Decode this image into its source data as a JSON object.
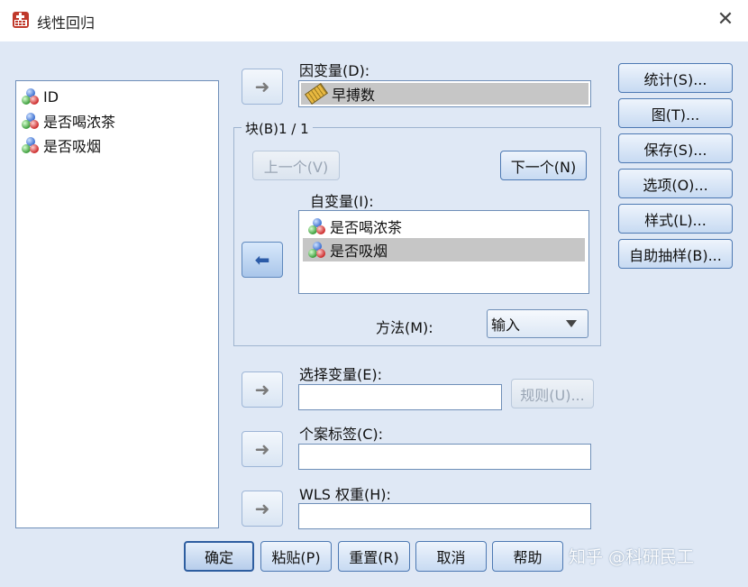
{
  "window": {
    "title": "线性回归",
    "close_glyph": "✕"
  },
  "source_list": {
    "items": [
      {
        "label": "ID",
        "icon": "nominal-icon"
      },
      {
        "label": "是否喝浓茶",
        "icon": "nominal-icon"
      },
      {
        "label": "是否吸烟",
        "icon": "nominal-icon"
      }
    ]
  },
  "dependent": {
    "label": "因变量(D):",
    "value": "早搏数",
    "icon": "scale-ruler-icon"
  },
  "block": {
    "legend": "块(B)1 / 1",
    "prev_label": "上一个(V)",
    "next_label": "下一个(N)"
  },
  "independent": {
    "label": "自变量(I):",
    "items": [
      {
        "label": "是否喝浓茶",
        "selected": false
      },
      {
        "label": "是否吸烟",
        "selected": true
      }
    ]
  },
  "method": {
    "label": "方法(M):",
    "value": "输入"
  },
  "selection": {
    "label": "选择变量(E):",
    "value": "",
    "rule_label": "规则(U)..."
  },
  "case_labels": {
    "label": "个案标签(C):",
    "value": ""
  },
  "wls": {
    "label": "WLS 权重(H):",
    "value": ""
  },
  "side_buttons": {
    "statistics": "统计(S)...",
    "plots": "图(T)...",
    "save": "保存(S)...",
    "options": "选项(O)...",
    "style": "样式(L)...",
    "bootstrap": "自助抽样(B)..."
  },
  "bottom_buttons": {
    "ok": "确定",
    "paste": "粘贴(P)",
    "reset": "重置(R)",
    "cancel": "取消",
    "help": "帮助"
  },
  "watermark": "知乎 @科研民工",
  "colors": {
    "client_bg": "#dfe8f5",
    "selection_gray": "#c6c6c6",
    "button_border": "#4d79b3"
  }
}
